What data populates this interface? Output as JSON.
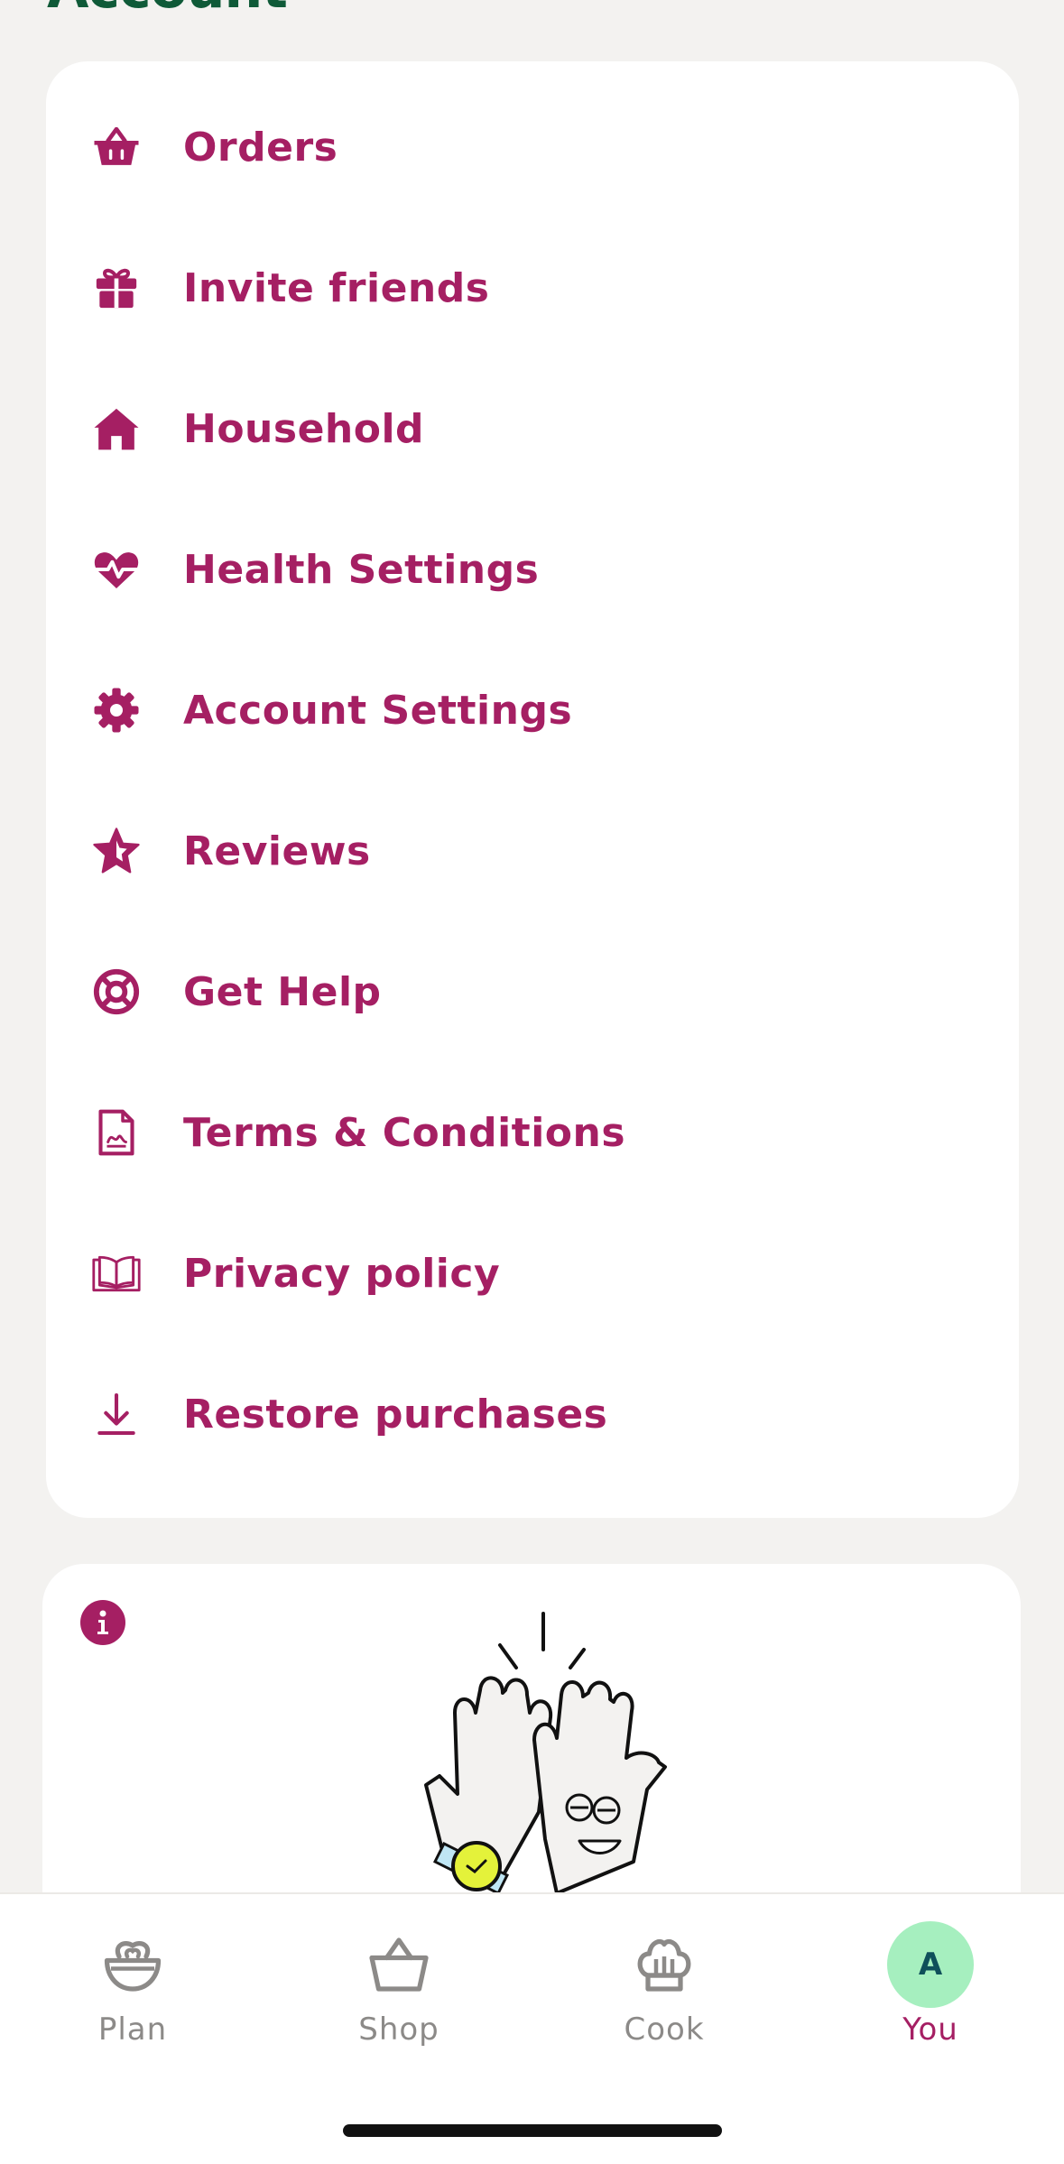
{
  "page": {
    "title": "Account"
  },
  "menu": {
    "items": [
      {
        "label": "Orders",
        "icon": "basket-icon"
      },
      {
        "label": "Invite friends",
        "icon": "gift-icon"
      },
      {
        "label": "Household",
        "icon": "house-icon"
      },
      {
        "label": "Health Settings",
        "icon": "heart-pulse-icon"
      },
      {
        "label": "Account Settings",
        "icon": "gear-icon"
      },
      {
        "label": "Reviews",
        "icon": "star-icon"
      },
      {
        "label": "Get Help",
        "icon": "lifebuoy-icon"
      },
      {
        "label": "Terms & Conditions",
        "icon": "document-icon"
      },
      {
        "label": "Privacy policy",
        "icon": "open-book-icon"
      },
      {
        "label": "Restore purchases",
        "icon": "download-icon"
      }
    ]
  },
  "info_card": {
    "icon": "info-icon",
    "illustration": "high-five-gloves-illustration"
  },
  "tabbar": {
    "tabs": [
      {
        "label": "Plan",
        "icon": "bowl-icon",
        "active": false
      },
      {
        "label": "Shop",
        "icon": "basket-outline-icon",
        "active": false
      },
      {
        "label": "Cook",
        "icon": "chef-hat-icon",
        "active": false
      },
      {
        "label": "You",
        "icon": "avatar",
        "active": true
      }
    ],
    "avatar_initial": "A"
  },
  "colors": {
    "accent": "#a51f63",
    "title_green": "#0f5a38",
    "background": "#f3f2f0",
    "avatar_bg": "#a6efbf",
    "inactive_tab": "#8c8a88"
  }
}
